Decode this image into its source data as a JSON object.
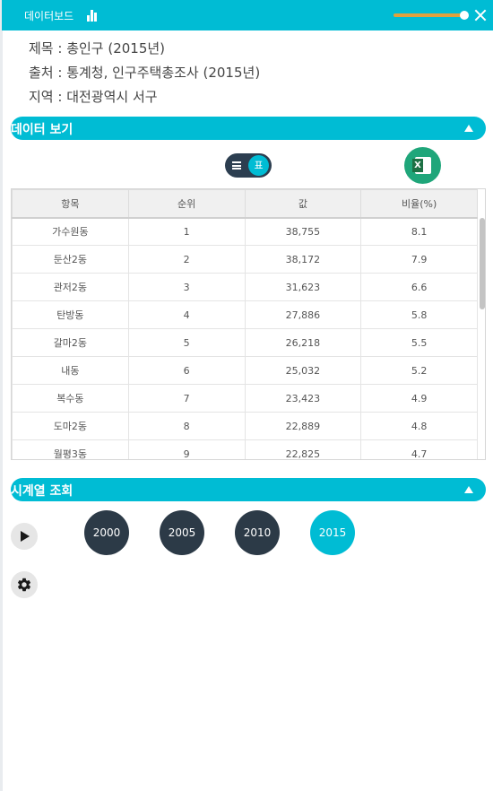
{
  "window": {
    "title": "데이터보드",
    "chart_icon": "bar-chart-icon",
    "opacity_slider_value": 0.95,
    "close_icon": "close-icon"
  },
  "meta": {
    "title": "제목 : 총인구 (2015년)",
    "source": "출처 : 통계청, 인구주택총조사 (2015년)",
    "region": "지역 : 대전광역시 서구"
  },
  "data_section": {
    "label": "데이터 보기",
    "collapse_icon": "caret-up-icon",
    "view_toggle": {
      "list_icon": "list-icon",
      "table_label": "표"
    },
    "excel_icon": "excel-icon",
    "excel_label": "X"
  },
  "table": {
    "headers": [
      "항목",
      "순위",
      "값",
      "비율(%)"
    ],
    "rows": [
      [
        "가수원동",
        "1",
        "38,755",
        "8.1"
      ],
      [
        "둔산2동",
        "2",
        "38,172",
        "7.9"
      ],
      [
        "관저2동",
        "3",
        "31,623",
        "6.6"
      ],
      [
        "탄방동",
        "4",
        "27,886",
        "5.8"
      ],
      [
        "갈마2동",
        "5",
        "26,218",
        "5.5"
      ],
      [
        "내동",
        "6",
        "25,032",
        "5.2"
      ],
      [
        "복수동",
        "7",
        "23,423",
        "4.9"
      ],
      [
        "도마2동",
        "8",
        "22,889",
        "4.8"
      ],
      [
        "월평3동",
        "9",
        "22,825",
        "4.7"
      ]
    ]
  },
  "timeseries_section": {
    "label": "시계열 조회",
    "collapse_icon": "caret-up-icon",
    "play_icon": "play-icon",
    "settings_icon": "gear-icon",
    "years": [
      "2000",
      "2005",
      "2010",
      "2015"
    ],
    "active_year": "2015"
  },
  "colors": {
    "accent": "#00bcd4",
    "dark_button": "#2c3a47",
    "slider_track": "#e0a13c",
    "excel_green": "#1fa67a"
  }
}
